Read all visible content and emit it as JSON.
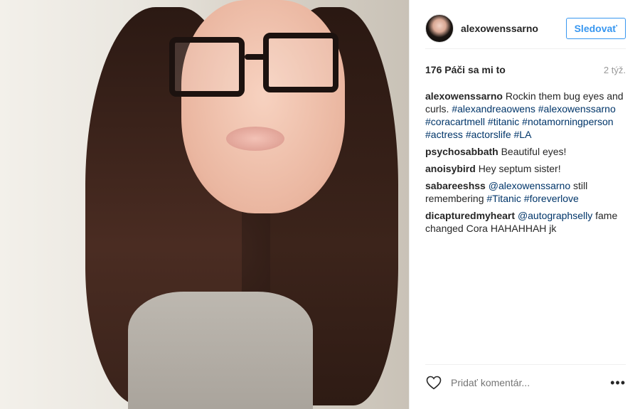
{
  "post": {
    "username": "alexowenssarno",
    "follow_label": "Sledovať",
    "likes": "176 Páči sa mi to",
    "time": "2 týž.",
    "comments": [
      {
        "author": "alexowenssarno",
        "text": "Rockin them bug eyes and curls.",
        "tags": [
          "#alexandreaowens",
          "#alexowenssarno",
          "#coracartmell",
          "#titanic",
          "#notamorningperson",
          "#actress",
          "#actorslife",
          "#LA"
        ]
      },
      {
        "author": "psychosabbath",
        "text": "Beautiful eyes!"
      },
      {
        "author": "anoisybird",
        "text": "Hey septum sister!"
      },
      {
        "author": "sabareeshss",
        "mention": "@alexowenssarno",
        "text": "still remembering",
        "tags": [
          "#Titanic",
          "#foreverlove"
        ]
      },
      {
        "author": "dicapturedmyheart",
        "mention": "@autographselly",
        "text": "fame changed Cora HAHAHHAH jk"
      }
    ],
    "comment_placeholder": "Pridať komentár...",
    "more_label": "•••",
    "icons": {
      "heart": "heart-outline-icon",
      "avatar": "avatar"
    }
  }
}
